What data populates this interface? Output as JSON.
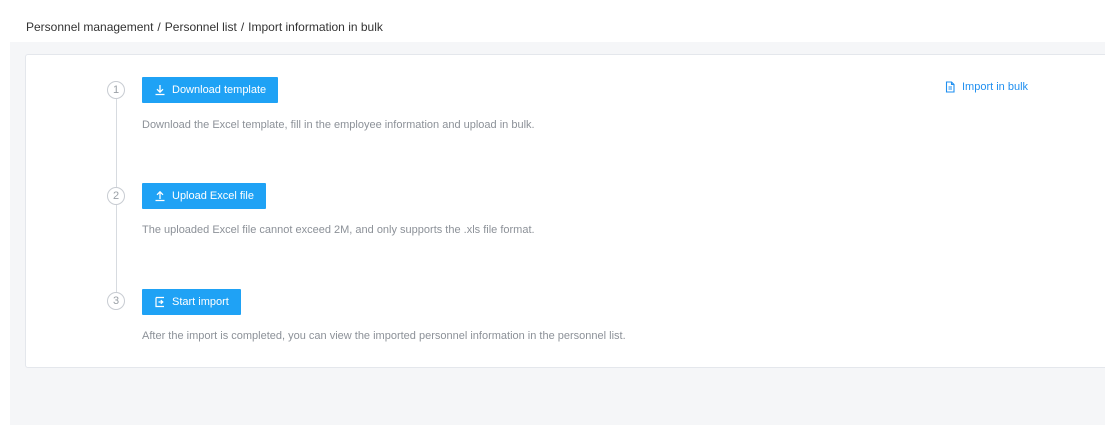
{
  "breadcrumb": {
    "items": [
      "Personnel management",
      "Personnel list",
      "Import information in bulk"
    ],
    "separator": "/"
  },
  "steps": [
    {
      "number": "1",
      "button_label": "Download template",
      "button_icon": "download-icon",
      "description": "Download the Excel template, fill in the employee information and upload in bulk."
    },
    {
      "number": "2",
      "button_label": "Upload Excel file",
      "button_icon": "upload-icon",
      "description": "The uploaded Excel file cannot exceed 2M, and only supports the .xls file format."
    },
    {
      "number": "3",
      "button_label": "Start import",
      "button_icon": "import-icon",
      "description": "After the import is completed, you can view the imported personnel information in the personnel list."
    }
  ],
  "import_link": {
    "label": "Import in bulk",
    "icon": "document-icon"
  },
  "colors": {
    "primary": "#1fa2f5",
    "link": "#1f8ff0",
    "muted_text": "#8c9198",
    "page_bg": "#f5f6f8"
  }
}
